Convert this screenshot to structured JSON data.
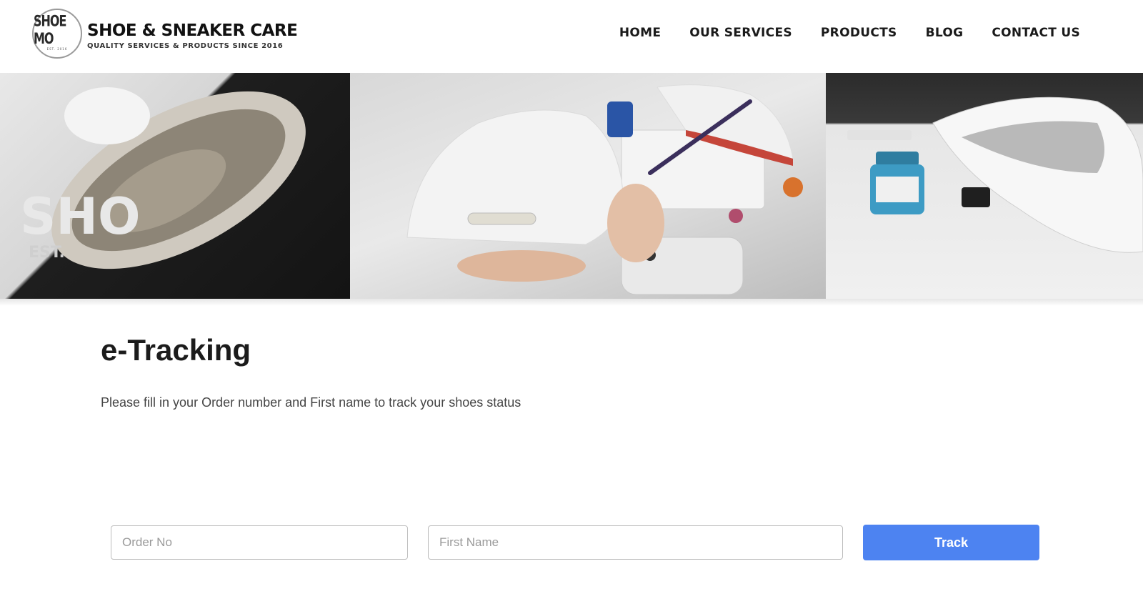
{
  "brand": {
    "badge_text": "SHOE MO",
    "badge_est": "EST. 2016",
    "name": "SHOE & SNEAKER CARE",
    "tagline": "QUALITY SERVICES & PRODUCTS SINCE 2016"
  },
  "nav": {
    "items": [
      {
        "label": "HOME"
      },
      {
        "label": "OUR SERVICES"
      },
      {
        "label": "PRODUCTS"
      },
      {
        "label": "BLOG"
      },
      {
        "label": "CONTACT US"
      }
    ]
  },
  "banner": {
    "images": [
      "sneaker-sole-cleaning-photo",
      "sneaker-painting-photo",
      "sneaker-paint-bottle-photo"
    ]
  },
  "main": {
    "title": "e-Tracking",
    "description": "Please fill in your Order number and First name to track your shoes status"
  },
  "form": {
    "order_placeholder": "Order No",
    "order_value": "",
    "name_placeholder": "First Name",
    "name_value": "",
    "submit_label": "Track"
  },
  "colors": {
    "accent": "#4d83f1",
    "text": "#1b1b1b"
  }
}
